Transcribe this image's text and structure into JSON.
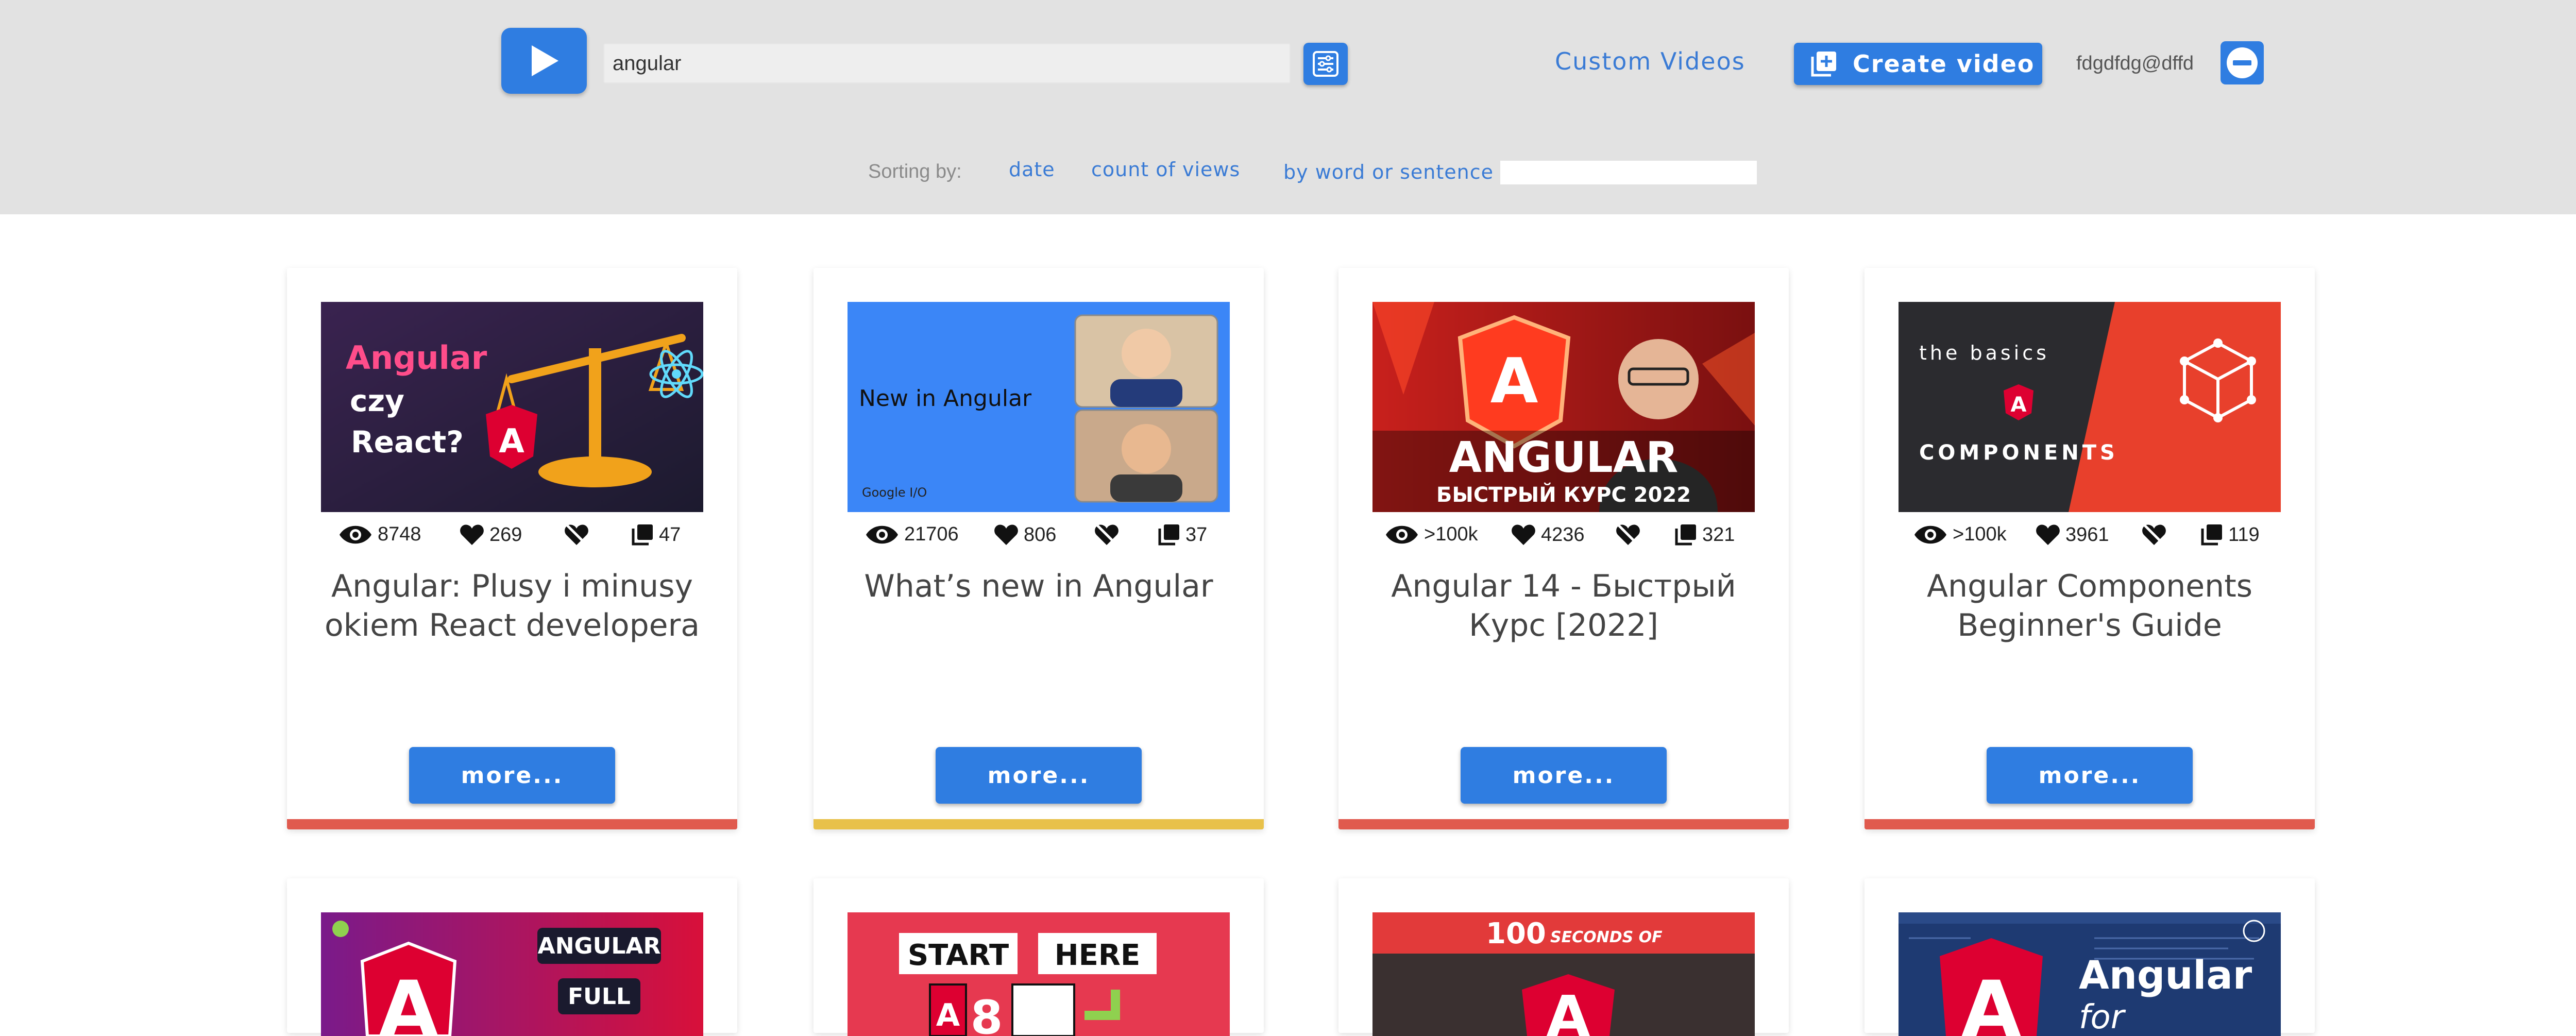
{
  "header": {
    "search_value": "angular",
    "custom_videos_label": "Custom Videos",
    "create_video_label": "Create video",
    "user_email": "fdgdfdg@dffd",
    "sorting_label": "Sorting by:",
    "sort_options": [
      "date",
      "count of views",
      "by word or sentence"
    ],
    "sort_input_value": ""
  },
  "colors": {
    "accent": "#2f7de1",
    "header_bg": "#e2e2e2",
    "bar_red": "#e05a4e",
    "bar_yellow": "#e8c14a"
  },
  "cards": [
    {
      "title": "Angular: Plusy i minusy okiem React developera",
      "views": "8748",
      "likes": "269",
      "copies": "47",
      "more_label": "more...",
      "thumb_text": [
        "Angular",
        "czy",
        "React?"
      ],
      "bar_color": "red"
    },
    {
      "title": "What’s new in Angular",
      "views": "21706",
      "likes": "806",
      "copies": "37",
      "more_label": "more...",
      "thumb_text": [
        "New in Angular",
        "Google I/O"
      ],
      "bar_color": "yellow"
    },
    {
      "title": "Angular 14 - Быстрый Курс [2022]",
      "views": ">100k",
      "likes": "4236",
      "copies": "321",
      "more_label": "more...",
      "thumb_text": [
        "ANGULAR",
        "БЫСТРЫЙ КУРС 2022"
      ],
      "bar_color": "red"
    },
    {
      "title": "Angular Components Beginner's Guide",
      "views": ">100k",
      "likes": "3961",
      "copies": "119",
      "more_label": "more...",
      "thumb_text": [
        "the basics",
        "COMPONENTS"
      ],
      "bar_color": "red"
    }
  ],
  "cards_row2": [
    {
      "thumb_text": [
        "ANGULAR",
        "FULL"
      ]
    },
    {
      "thumb_text": [
        "START",
        "HERE",
        "8"
      ]
    },
    {
      "thumb_text": [
        "100",
        "SECONDS OF"
      ]
    },
    {
      "thumb_text": [
        "Angular",
        "for"
      ]
    }
  ]
}
